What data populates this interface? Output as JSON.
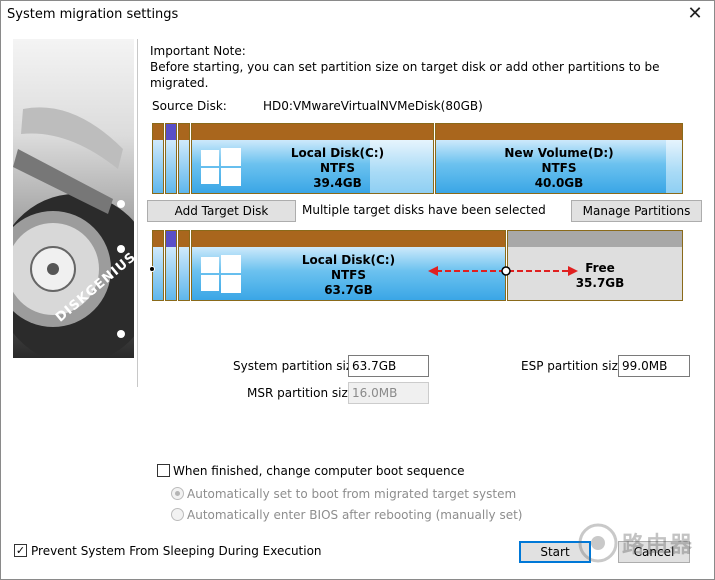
{
  "window": {
    "title": "System migration settings",
    "close_glyph": "✕"
  },
  "note": {
    "heading": "Important Note:",
    "text": "Before starting, you can set partition size on target disk or add other partitions to be migrated."
  },
  "source_disk": {
    "label": "Source Disk:",
    "value": "HD0:VMwareVirtualNVMeDisk(80GB)"
  },
  "source_partitions": [
    {
      "name": "Local Disk(C:)",
      "fs": "NTFS",
      "size": "39.4GB"
    },
    {
      "name": "New Volume(D:)",
      "fs": "NTFS",
      "size": "40.0GB"
    }
  ],
  "target_controls": {
    "add_target_label": "Add Target Disk",
    "status_text": "Multiple target disks have been selected",
    "manage_label": "Manage Partitions"
  },
  "target_partitions": [
    {
      "name": "Local Disk(C:)",
      "fs": "NTFS",
      "size": "63.7GB"
    },
    {
      "name": "Free",
      "size": "35.7GB"
    }
  ],
  "sizes": {
    "system_label": "System partition size:",
    "system_value": "63.7GB",
    "esp_label": "ESP partition size:",
    "esp_value": "99.0MB",
    "msr_label": "MSR partition size:",
    "msr_value": "16.0MB"
  },
  "boot": {
    "change_label": "When finished, change computer boot sequence",
    "change_checked": false,
    "option_auto": "Automatically set to boot from migrated target system",
    "option_bios": "Automatically enter BIOS after rebooting (manually set)"
  },
  "prevent_sleep": {
    "label": "Prevent System From Sleeping During Execution",
    "checked": true,
    "glyph": "✓"
  },
  "buttons": {
    "start": "Start",
    "cancel": "Cancel"
  },
  "sidebar_brand": "DISKGENIUS",
  "watermark_text": "路由器",
  "colors": {
    "partition_header": "#a9661d",
    "partition_fill": "#3aa6e6",
    "free_fill": "#dedede",
    "resize_arrow": "#e02020",
    "default_button_border": "#0078d7"
  }
}
